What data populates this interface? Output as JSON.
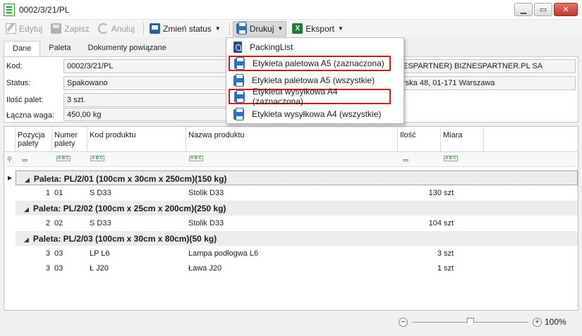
{
  "window": {
    "title": "0002/3/21/PL"
  },
  "toolbar": {
    "edit": "Edytuj",
    "save": "Zapisz",
    "cancel": "Anuluj",
    "change_status": "Zmień status",
    "print": "Drukuj",
    "export": "Eksport"
  },
  "tabs": [
    "Dane",
    "Paleta",
    "Dokumenty powiązane"
  ],
  "fields": {
    "code_label": "Kod:",
    "code_value": "0002/3/21/PL",
    "status_label": "Status:",
    "status_value": "Spakowano",
    "pallets_label": "Ilość palet:",
    "pallets_value": "3 szt.",
    "weight_label": "Łączna waga:",
    "weight_value": "450,00 kg",
    "client_value": "ESPARTNER) BIZNESPARTNER.PL SA",
    "address_value": "rska 48, 01-171 Warszawa"
  },
  "print_menu": {
    "items": [
      "PackingList",
      "Etykieta paletowa A5 (zaznaczona)",
      "Etykieta paletowa A5 (wszystkie)",
      "Etykieta wysyłkowa A4 (zaznaczona)",
      "Etykieta wysyłkowa A4 (wszystkie)"
    ]
  },
  "grid": {
    "columns": [
      "Pozycja\npalety",
      "Numer\npalety",
      "Kod produktu",
      "Nazwa produktu",
      "Ilość",
      "Miara"
    ],
    "groups": [
      {
        "label": "Paleta: PL/2/01 (100cm x 30cm x 250cm)(150 kg)",
        "rows": [
          {
            "pos": "1",
            "num": "01",
            "code": "S D33",
            "name": "Stolik D33",
            "qty": "130",
            "unit": "szt"
          }
        ]
      },
      {
        "label": "Paleta: PL/2/02 (100cm x 25cm x 200cm)(250 kg)",
        "rows": [
          {
            "pos": "2",
            "num": "02",
            "code": "S D33",
            "name": "Stolik D33",
            "qty": "104",
            "unit": "szt"
          }
        ]
      },
      {
        "label": "Paleta: PL/2/03 (100cm x 30cm x 80cm)(50 kg)",
        "rows": [
          {
            "pos": "3",
            "num": "03",
            "code": "LP L6",
            "name": "Lampa podłogwa L6",
            "qty": "3",
            "unit": "szt"
          },
          {
            "pos": "3",
            "num": "03",
            "code": "Ł J20",
            "name": "Ława J20",
            "qty": "1",
            "unit": "szt"
          }
        ]
      }
    ]
  },
  "zoom": {
    "level": "100%"
  },
  "colors": {
    "highlight_border": "#d11a1a",
    "group_bg": "#ececec"
  }
}
